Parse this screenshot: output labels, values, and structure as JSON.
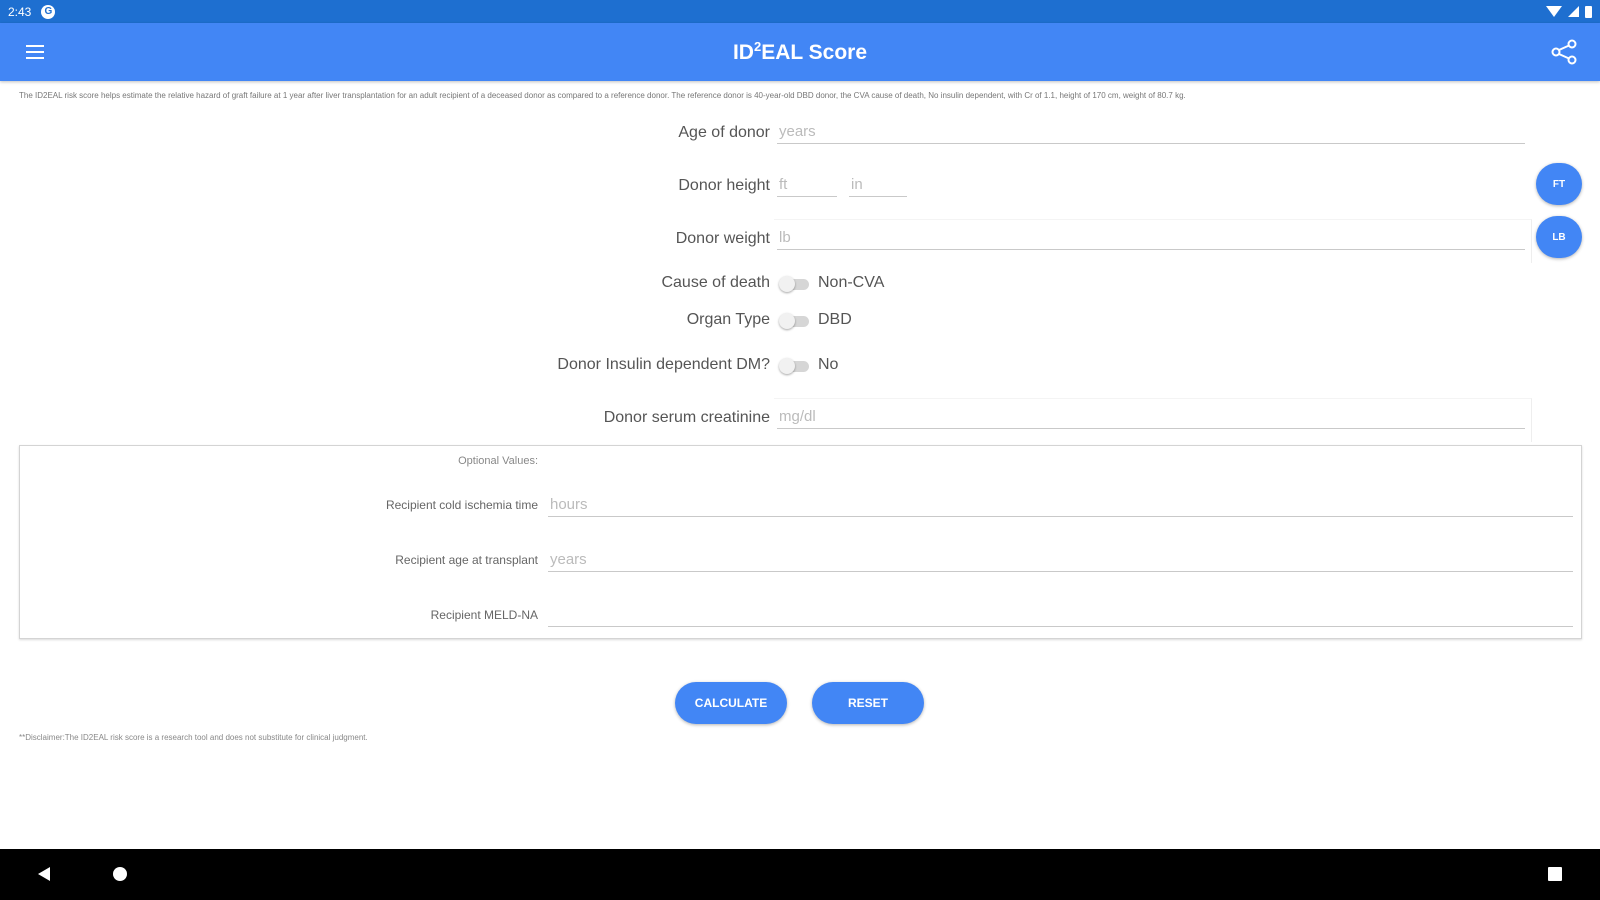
{
  "status_bar": {
    "time": "2:43",
    "notification_icon": "G"
  },
  "app_bar": {
    "title_prefix": "ID",
    "title_sup": "2",
    "title_suffix": "EAL Score"
  },
  "intro_text": "The ID2EAL risk score helps estimate the relative hazard of graft failure at 1 year after liver transplantation for an adult recipient of a deceased donor as compared to a reference donor. The reference donor is 40-year-old DBD donor, the CVA cause of death, No insulin dependent, with Cr of 1.1, height of 170 cm, weight of 80.7 kg.",
  "form": {
    "age": {
      "label": "Age of donor",
      "placeholder": "years"
    },
    "height": {
      "label": "Donor height",
      "ft_placeholder": "ft",
      "in_placeholder": "in",
      "unit_button": "FT"
    },
    "weight": {
      "label": "Donor weight",
      "placeholder": "lb",
      "unit_button": "LB"
    },
    "cause_of_death": {
      "label": "Cause of death",
      "value": "Non-CVA"
    },
    "organ_type": {
      "label": "Organ Type",
      "value": "DBD"
    },
    "insulin": {
      "label": "Donor Insulin dependent DM?",
      "value": "No"
    },
    "creatinine": {
      "label": "Donor serum creatinine",
      "placeholder": "mg/dl"
    }
  },
  "optional": {
    "title": "Optional Values:",
    "cold_ischemia": {
      "label": "Recipient cold ischemia time",
      "placeholder": "hours"
    },
    "recipient_age": {
      "label": "Recipient age at transplant",
      "placeholder": "years"
    },
    "meld": {
      "label": "Recipient MELD-NA",
      "placeholder": ""
    }
  },
  "buttons": {
    "calculate": "CALCULATE",
    "reset": "RESET"
  },
  "disclaimer": "**Disclaimer:The ID2EAL risk score is a research tool and does not substitute for clinical judgment."
}
